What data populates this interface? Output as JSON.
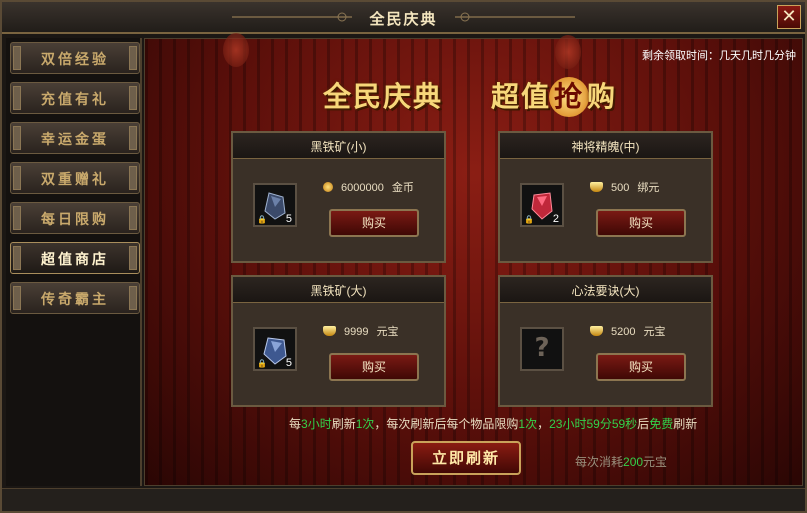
{
  "window": {
    "title": "全民庆典",
    "close_symbol": "✕"
  },
  "sidebar": {
    "items": [
      {
        "label": "双倍经验",
        "active": false
      },
      {
        "label": "充值有礼",
        "active": false
      },
      {
        "label": "幸运金蛋",
        "active": false
      },
      {
        "label": "双重赠礼",
        "active": false
      },
      {
        "label": "每日限购",
        "active": false
      },
      {
        "label": "超值商店",
        "active": true
      },
      {
        "label": "传奇霸主",
        "active": false
      }
    ]
  },
  "main": {
    "countdown": "剩余领取时间：几天几时几分钟",
    "banner_left": "全民庆典",
    "banner_right_a": "超值",
    "banner_right_grab": "抢",
    "banner_right_b": "购"
  },
  "items": [
    {
      "name": "黑铁矿(小)",
      "quantity": "5",
      "price": "6000000",
      "currency": "金币",
      "currency_icon": "coin-icon",
      "buy_label": "购买",
      "gem_color": "#3b4a6a"
    },
    {
      "name": "神将精魄(中)",
      "quantity": "2",
      "price": "500",
      "currency": "绑元",
      "currency_icon": "ingot-icon",
      "buy_label": "购买",
      "gem_color": "#c0283a"
    },
    {
      "name": "黑铁矿(大)",
      "quantity": "5",
      "price": "9999",
      "currency": "元宝",
      "currency_icon": "ingot-icon",
      "buy_label": "购买",
      "gem_color": "#3e5890"
    },
    {
      "name": "心法要诀(大)",
      "quantity": "",
      "price": "5200",
      "currency": "元宝",
      "currency_icon": "ingot-icon",
      "buy_label": "购买",
      "gem_color": ""
    }
  ],
  "info": {
    "p1": "每",
    "hours": "3小时",
    "p2": "刷新",
    "times": "1次",
    "p3": "，每次刷新后每个物品限购",
    "limit": "1次",
    "p4": "，",
    "timer": "23小时59分59秒",
    "p5": "后",
    "free": "免费",
    "p6": "刷新"
  },
  "refresh": {
    "label": "立即刷新"
  },
  "cost": {
    "prefix": "每次消耗",
    "amount": "200",
    "suffix": "元宝"
  },
  "colors": {
    "accent_green": "#33d14a",
    "title_gold": "#f7d77a",
    "panel_red": "#5a0f0a"
  }
}
